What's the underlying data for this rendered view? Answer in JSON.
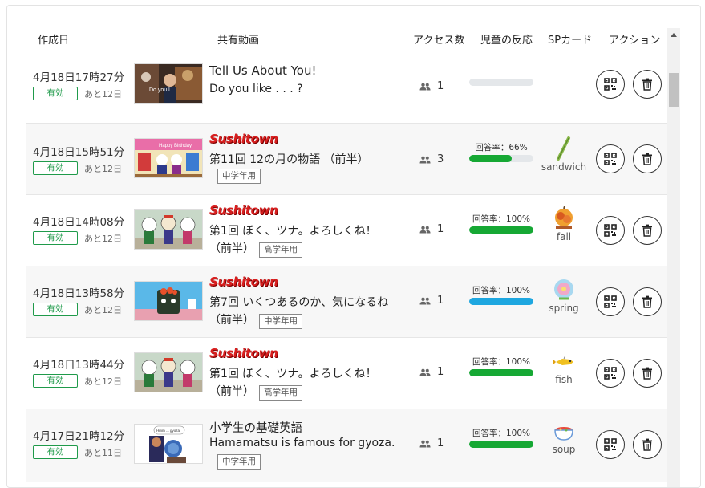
{
  "headers": {
    "created": "作成日",
    "video": "共有動画",
    "access": "アクセス数",
    "reaction": "児童の反応",
    "sp": "SPカード",
    "action": "アクション"
  },
  "rows": [
    {
      "date": "4月18日17時27分",
      "status": "有効",
      "remaining": "あと12日",
      "logo": "",
      "title1": "Tell Us About You!",
      "title2": "Do you like . . . ?",
      "grade": "",
      "access": "1",
      "rate_label": "",
      "rate": 0,
      "bar_color": "#e4e7ea",
      "sp_label": "",
      "sp_icon": ""
    },
    {
      "date": "4月18日15時51分",
      "status": "有効",
      "remaining": "あと12日",
      "logo": "Sushitown",
      "title1": "第11回 12の月の物語 （前半）",
      "title2": "",
      "grade": "中学年用",
      "access": "3",
      "rate_label": "回答率：66%",
      "rate": 0.66,
      "bar_color": "#16a834",
      "sp_label": "sandwich",
      "sp_icon": "sandwich-icon"
    },
    {
      "date": "4月18日14時08分",
      "status": "有効",
      "remaining": "あと12日",
      "logo": "Sushitown",
      "title1": "第1回 ぼく、ツナ。よろしくね！",
      "title2": "（前半）",
      "grade": "高学年用",
      "access": "1",
      "rate_label": "回答率：100%",
      "rate": 1.0,
      "bar_color": "#16a834",
      "sp_label": "fall",
      "sp_icon": "fall-icon"
    },
    {
      "date": "4月18日13時58分",
      "status": "有効",
      "remaining": "あと12日",
      "logo": "Sushitown",
      "title1": "第7回 いくつあるのか、気になるね",
      "title2": "（前半）",
      "grade": "中学年用",
      "access": "1",
      "rate_label": "回答率：100%",
      "rate": 1.0,
      "bar_color": "#1ea7e0",
      "sp_label": "spring",
      "sp_icon": "spring-icon"
    },
    {
      "date": "4月18日13時44分",
      "status": "有効",
      "remaining": "あと12日",
      "logo": "Sushitown",
      "title1": "第1回 ぼく、ツナ。よろしくね！",
      "title2": "（前半）",
      "grade": "高学年用",
      "access": "1",
      "rate_label": "回答率：100%",
      "rate": 1.0,
      "bar_color": "#16a834",
      "sp_label": "fish",
      "sp_icon": "fish-icon"
    },
    {
      "date": "4月17日21時12分",
      "status": "有効",
      "remaining": "あと11日",
      "logo": "",
      "title1": "小学生の基礎英語",
      "title2": "Hamamatsu is famous for gyoza.",
      "grade": "中学年用",
      "access": "1",
      "rate_label": "回答率：100%",
      "rate": 1.0,
      "bar_color": "#16a834",
      "sp_label": "soup",
      "sp_icon": "soup-icon"
    }
  ],
  "colors": {
    "badge_green": "#1f9a4a",
    "logo_red": "#d81e1e",
    "progress_green": "#16a834",
    "progress_blue": "#1ea7e0"
  }
}
